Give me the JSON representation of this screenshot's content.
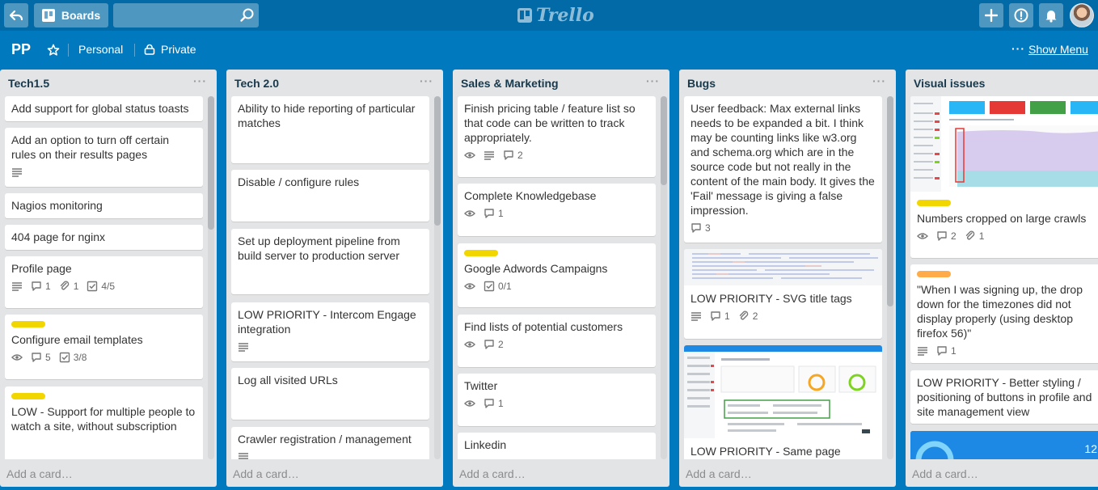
{
  "header": {
    "boards_label": "Boards",
    "search_placeholder": "",
    "logo_text": "Trello"
  },
  "board": {
    "name": "PP",
    "team": "Personal",
    "visibility": "Private",
    "menu_dots": "···",
    "show_menu_label": "Show Menu"
  },
  "add_card_label": "Add a card…",
  "lists": [
    {
      "title": "Tech1.5",
      "cards": [
        {
          "title": "Add support for global status toasts"
        },
        {
          "title": "Add an option to turn off certain rules on their results pages",
          "desc": true
        },
        {
          "title": "Nagios monitoring"
        },
        {
          "title": "404 page for nginx"
        },
        {
          "title": "Profile page",
          "desc": true,
          "comments": "1",
          "attachments": "1",
          "checklist": "4/5"
        },
        {
          "title": "Configure email templates",
          "label": "#f2d600",
          "watch": true,
          "comments": "5",
          "checklist": "3/8"
        },
        {
          "title": "LOW - Support for multiple people to watch a site, without subscription",
          "label": "#f2d600"
        }
      ]
    },
    {
      "title": "Tech 2.0",
      "cards": [
        {
          "title": "Ability to hide reporting of particular matches"
        },
        {
          "title": "Disable / configure rules"
        },
        {
          "title": "Set up deployment pipeline from build server to production server"
        },
        {
          "title": "LOW PRIORITY - Intercom Engage integration",
          "desc": true
        },
        {
          "title": "Log all visited URLs"
        },
        {
          "title": "Crawler registration / management",
          "desc": true
        }
      ]
    },
    {
      "title": "Sales & Marketing",
      "cards": [
        {
          "title": "Finish pricing table / feature list so that code can be written to track appropriately.",
          "watch": true,
          "desc": true,
          "comments": "2"
        },
        {
          "title": "Complete Knowledgebase",
          "watch": true,
          "comments": "1"
        },
        {
          "title": "Google Adwords Campaigns",
          "label": "#f2d600",
          "watch": true,
          "checklist": "0/1"
        },
        {
          "title": "Find lists of potential customers",
          "watch": true,
          "comments": "2"
        },
        {
          "title": "Twitter",
          "watch": true,
          "comments": "1"
        },
        {
          "title": "Linkedin"
        }
      ]
    },
    {
      "title": "Bugs",
      "cards": [
        {
          "title": "User feedback: Max external links needs to be expanded a bit. I think may be counting links like w3.org and schema.org which are in the source code but not really in the content of the main body. It gives the 'Fail' message is giving a false impression.",
          "comments": "3"
        },
        {
          "title": "LOW PRIORITY - SVG title tags",
          "desc": true,
          "comments": "1",
          "attachments": "2"
        },
        {
          "title": "LOW PRIORITY - Same page"
        }
      ]
    },
    {
      "title": "Visual issues",
      "cards": [
        {
          "title": "Numbers cropped on large crawls",
          "label": "#f2d600",
          "watch": true,
          "comments": "2",
          "attachments": "1"
        },
        {
          "title": "\"When I was signing up, the drop down for the timezones did not display properly (using desktop firefox 56)\"",
          "label": "#ffab4a",
          "desc": true,
          "comments": "1"
        },
        {
          "title": "LOW PRIORITY - Better styling / positioning of buttons in profile and site management view"
        },
        {
          "title": "",
          "cover_number": "12"
        }
      ]
    }
  ],
  "colors": {
    "board_bg": "#0079bf",
    "header_bg": "#026aa7",
    "list_bg": "#e2e4e6",
    "label_yellow": "#f2d600",
    "label_orange": "#ffab4a"
  }
}
